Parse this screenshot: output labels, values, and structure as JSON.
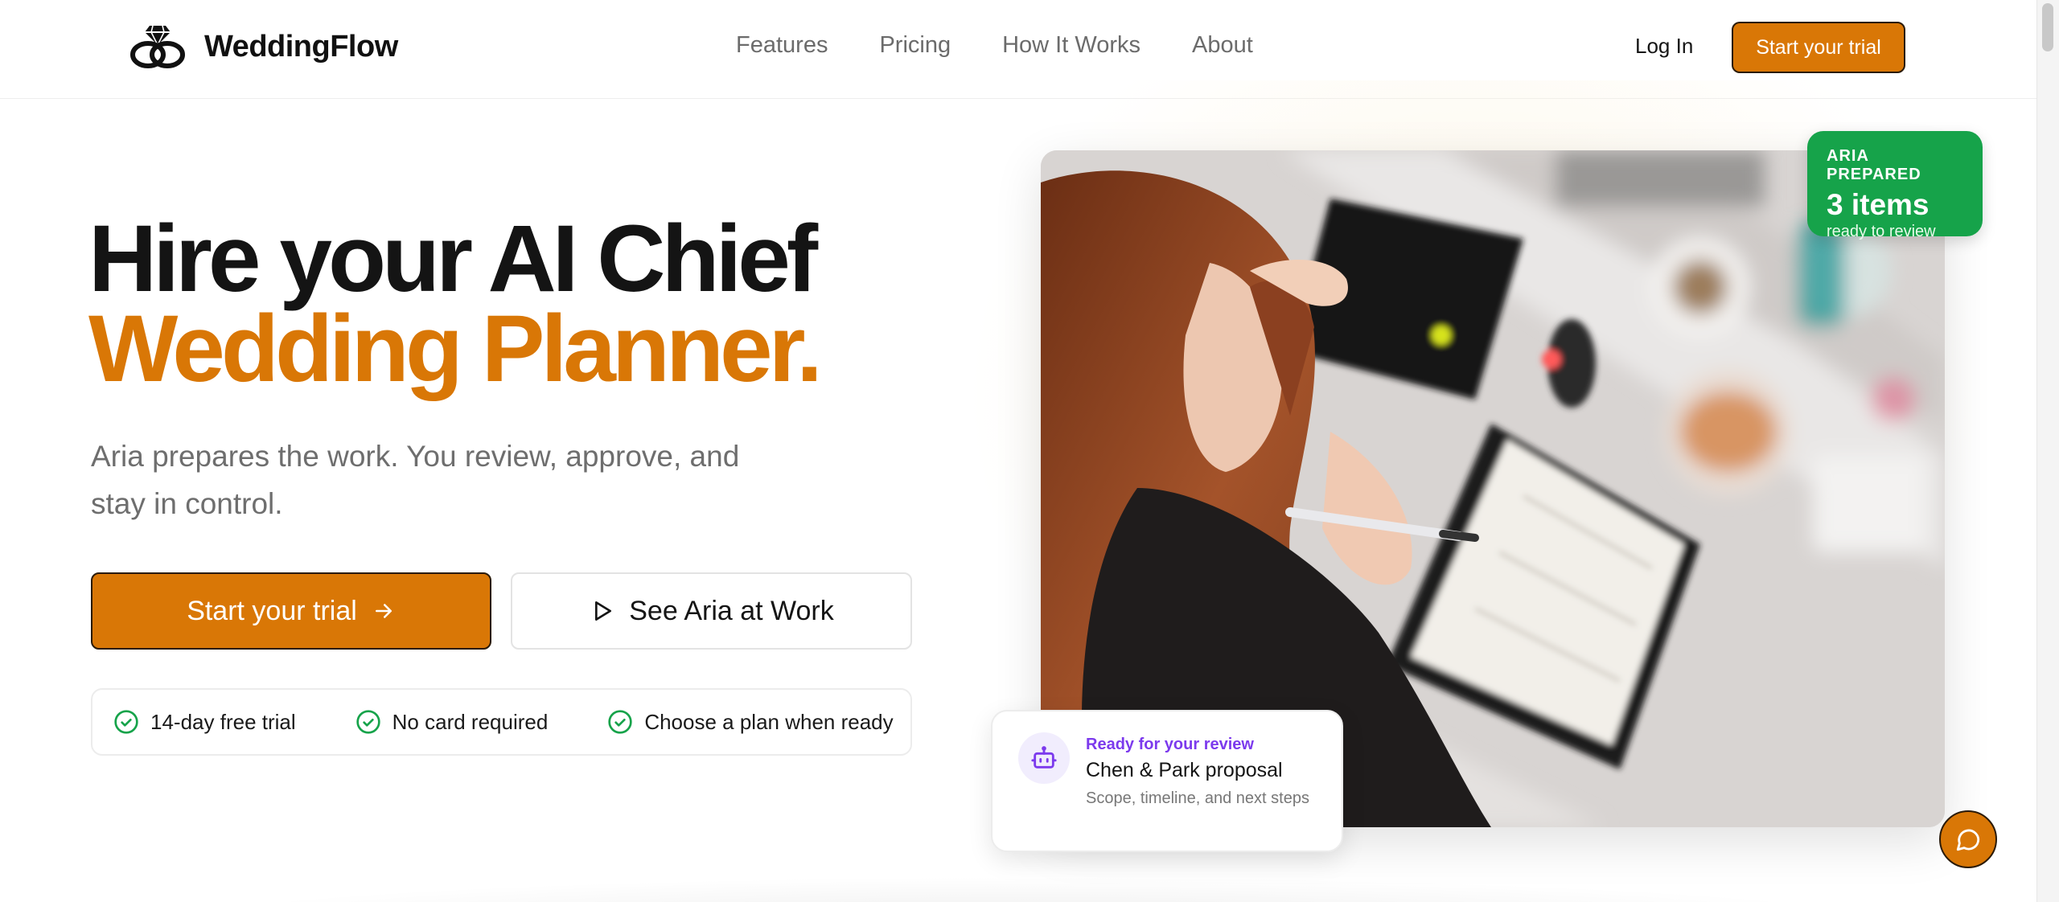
{
  "brand": {
    "name": "WeddingFlow",
    "logo_icon": "diamond-rings-icon"
  },
  "nav": {
    "items": [
      {
        "label": "Features"
      },
      {
        "label": "Pricing"
      },
      {
        "label": "How It Works"
      },
      {
        "label": "About"
      }
    ],
    "login_label": "Log In",
    "cta_label": "Start your trial"
  },
  "hero": {
    "title_line1": "Hire your AI Chief",
    "title_line2": "Wedding Planner.",
    "subtitle": "Aria prepares the work. You review, approve, and stay in control.",
    "primary_cta": "Start your trial",
    "secondary_cta": "See Aria at Work",
    "perks": [
      "14-day free trial",
      "No card required",
      "Choose a plan when ready"
    ]
  },
  "badge": {
    "label": "ARIA PREPARED",
    "count": "3 items",
    "caption": "ready to review"
  },
  "review_card": {
    "tag": "Ready for your review",
    "title": "Chen & Park proposal",
    "description": "Scope, timeline, and next steps"
  },
  "colors": {
    "accent": "#d97706",
    "success": "#16a34a",
    "purple": "#7c3aed",
    "text": "#151515",
    "muted": "#6e6e6e"
  }
}
